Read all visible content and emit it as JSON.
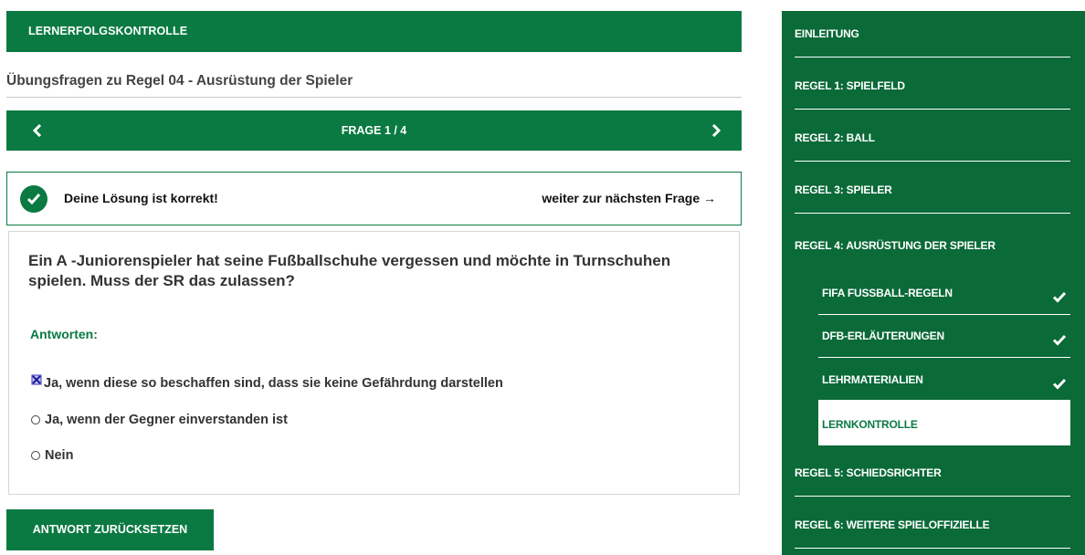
{
  "header": {
    "title": "LERNERFOLGSKONTROLLE"
  },
  "subtitle": "Übungsfragen zu Regel 04 - Ausrüstung der Spieler",
  "question_nav": {
    "counter": "FRAGE 1 / 4"
  },
  "feedback": {
    "message": "Deine Lösung ist korrekt!",
    "next_link": "weiter zur nächsten Frage →"
  },
  "question": {
    "text": "Ein A -Juniorenspieler hat seine Fußballschuhe vergessen und möchte in Turnschuhen spielen. Muss der SR das zulassen?",
    "answers_label": "Antworten:",
    "answers": [
      {
        "label": "Ja, wenn diese so beschaffen sind, dass sie keine Gefährdung darstellen",
        "selected": true
      },
      {
        "label": "Ja, wenn der Gegner einverstanden ist",
        "selected": false
      },
      {
        "label": "Nein",
        "selected": false
      }
    ]
  },
  "reset_button": "ANTWORT ZURÜCKSETZEN",
  "sidebar": {
    "items": [
      {
        "label": "EINLEITUNG"
      },
      {
        "label": "REGEL 1: SPIELFELD"
      },
      {
        "label": "REGEL 2: BALL"
      },
      {
        "label": "REGEL 3: SPIELER"
      },
      {
        "label": "REGEL 4: AUSRÜSTUNG DER SPIELER"
      },
      {
        "label": "REGEL 5: SCHIEDSRICHTER"
      },
      {
        "label": "REGEL 6: WEITERE SPIELOFFIZIELLE"
      }
    ],
    "sub_items": [
      {
        "label": "FIFA FUSSBALL-REGELN",
        "completed": true
      },
      {
        "label": "DFB-ERLÄUTERUNGEN",
        "completed": true
      },
      {
        "label": "LEHRMATERIALIEN",
        "completed": true
      },
      {
        "label": "LERNKONTROLLE",
        "completed": false,
        "active": true
      }
    ]
  },
  "colors": {
    "accent": "#0a7a42",
    "sidebar": "#0a6a38"
  },
  "icons": [
    "chevron-left-icon",
    "chevron-right-icon",
    "check-circle-icon",
    "checkmark-icon",
    "radio-icon",
    "selected-answer-icon"
  ]
}
